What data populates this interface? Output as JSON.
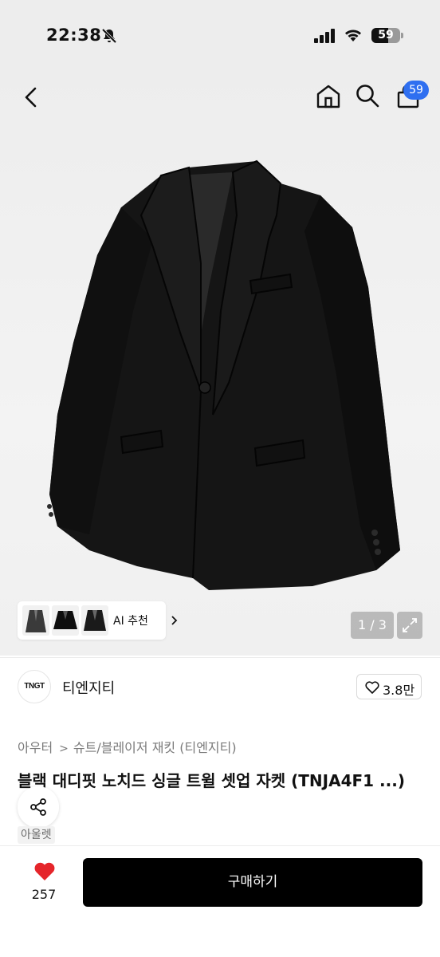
{
  "status_bar": {
    "time": "22:38",
    "battery": "59",
    "battery_level": 0.59
  },
  "header": {
    "cart_badge": "59"
  },
  "gallery": {
    "page_indicator": "1 / 3",
    "ai_recommend_label": "AI 추천"
  },
  "brand": {
    "logo_text": "TNGT",
    "name": "티엔지티",
    "likes": "3.8만"
  },
  "breadcrumb": {
    "category": "아우터",
    "subcategory": "슈트/블레이저 재킷 (티엔지티)"
  },
  "product": {
    "title": "블랙 대디핏 노치드 싱글 트윌 셋업 자켓 (TNJA4F1 ...)",
    "tag": "아울렛"
  },
  "actions": {
    "wish_count": "257",
    "buy_label": "구매하기"
  },
  "colors": {
    "badge": "#2f6ff0",
    "heart": "#e5252a",
    "buy_button": "#000000"
  },
  "icons": [
    "back-icon",
    "home-icon",
    "search-icon",
    "cart-icon",
    "expand-icon",
    "heart-icon",
    "share-icon",
    "bell-muted-icon"
  ]
}
